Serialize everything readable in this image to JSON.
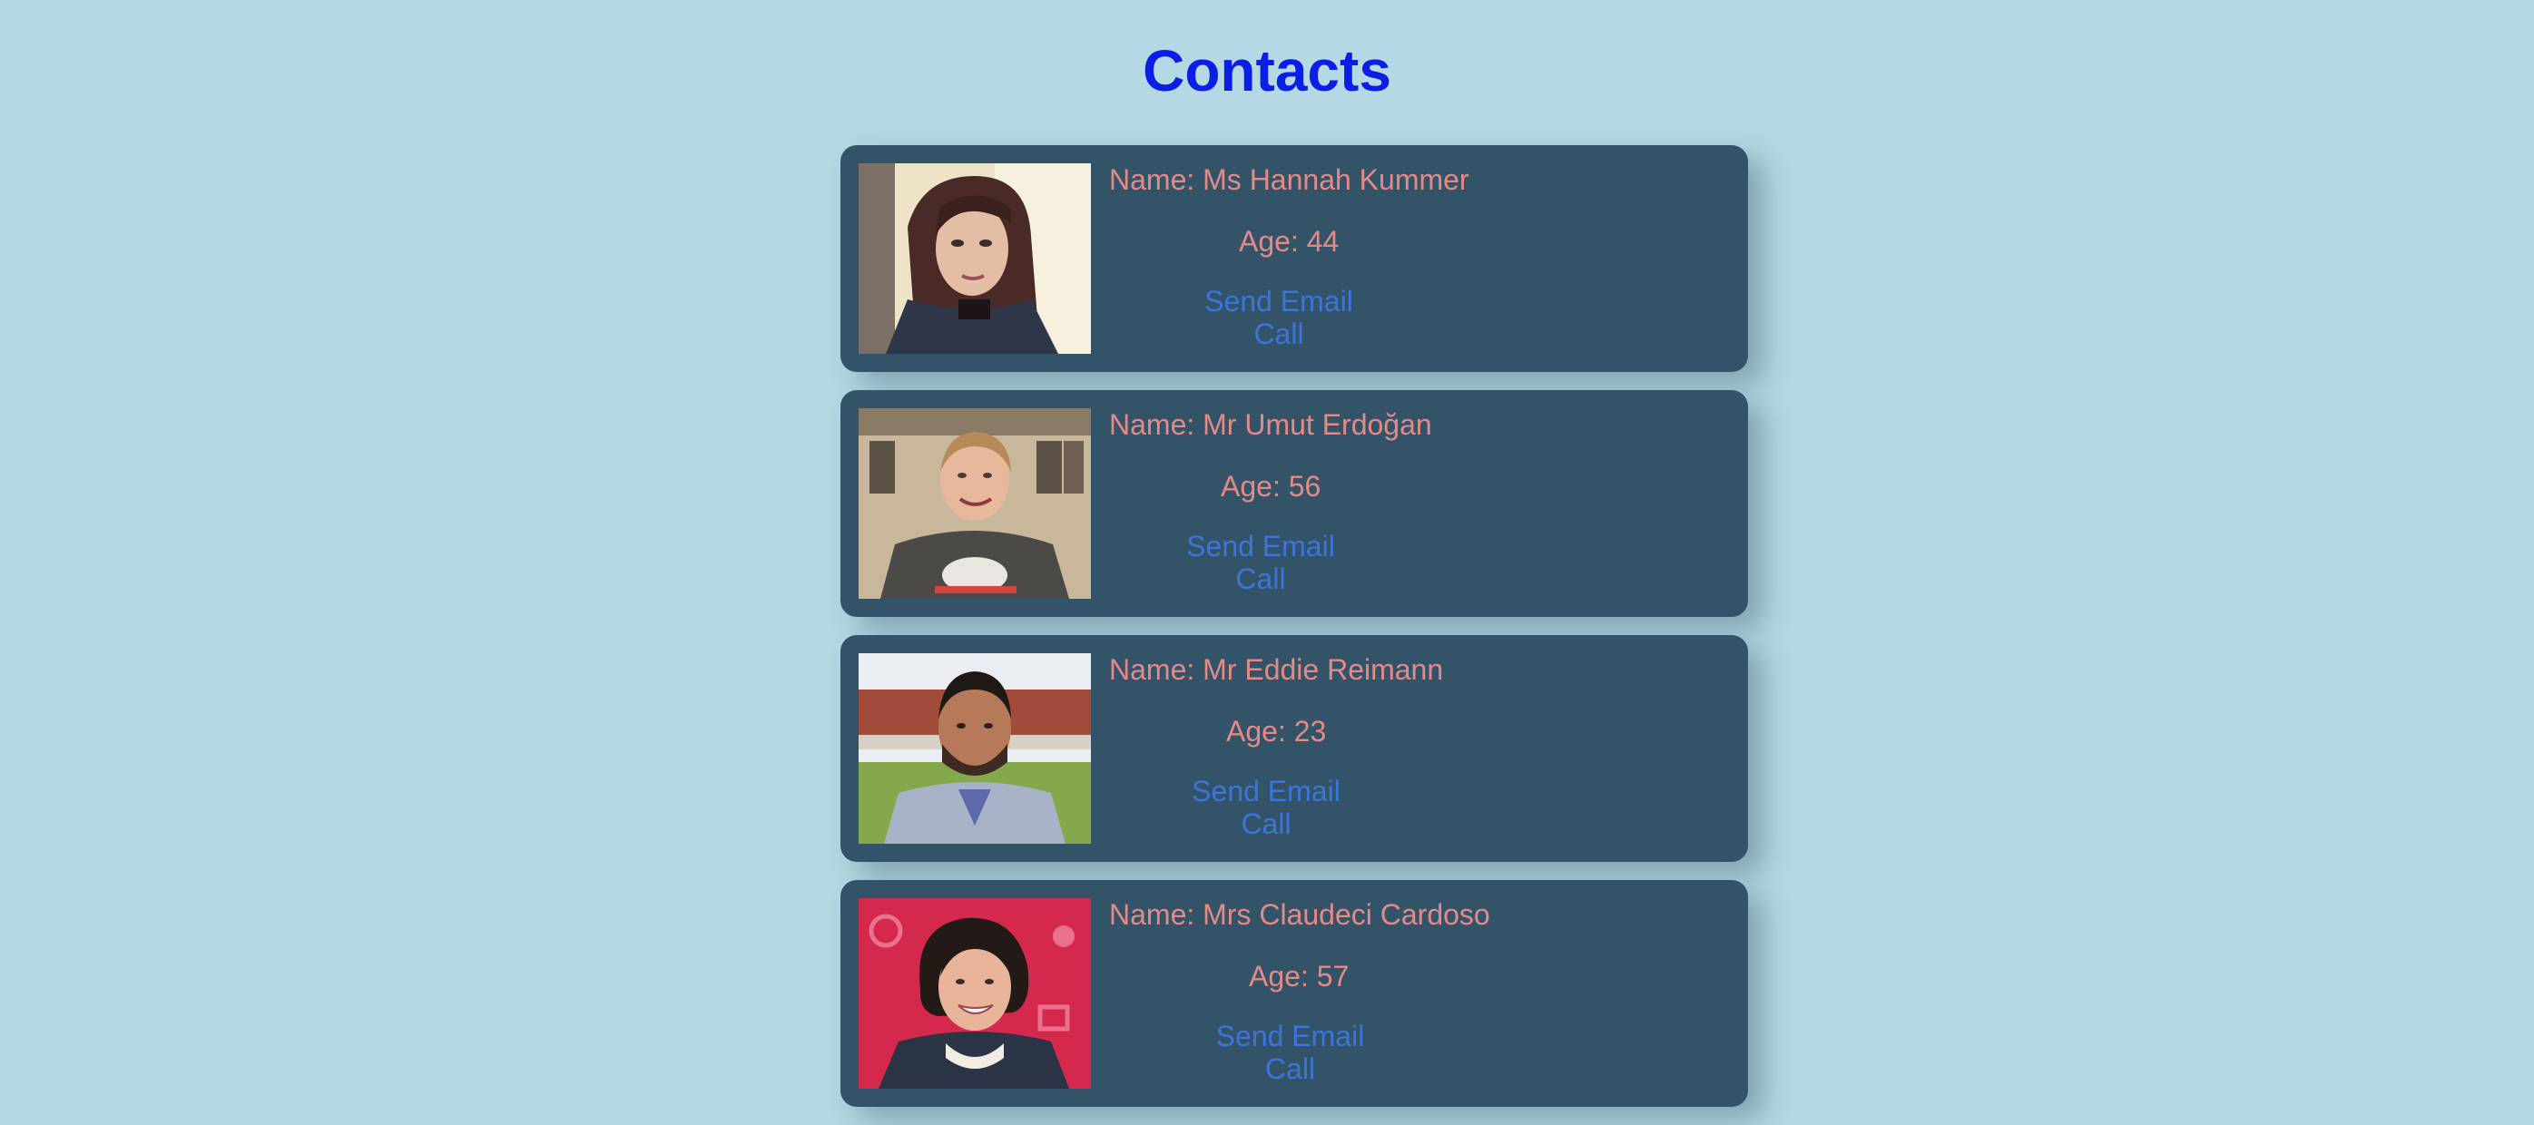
{
  "page": {
    "title": "Contacts"
  },
  "contacts": [
    {
      "name": "Name: Ms Hannah Kummer",
      "age": "Age: 44",
      "email_label": "Send Email",
      "call_label": "Call",
      "avatar_icon": "woman-portrait"
    },
    {
      "name": "Name: Mr Umut Erdoğan",
      "age": "Age: 56",
      "email_label": "Send Email",
      "call_label": "Call",
      "avatar_icon": "man-portrait"
    },
    {
      "name": "Name: Mr Eddie Reimann",
      "age": "Age: 23",
      "email_label": "Send Email",
      "call_label": "Call",
      "avatar_icon": "man-portrait"
    },
    {
      "name": "Name: Mrs Claudeci Cardoso",
      "age": "Age: 57",
      "email_label": "Send Email",
      "call_label": "Call",
      "avatar_icon": "woman-portrait"
    }
  ],
  "colors": {
    "background": "#b4d8e4",
    "title": "#0a1ee6",
    "card": "#335468",
    "text": "#e38a88",
    "link": "#3d74d9"
  }
}
